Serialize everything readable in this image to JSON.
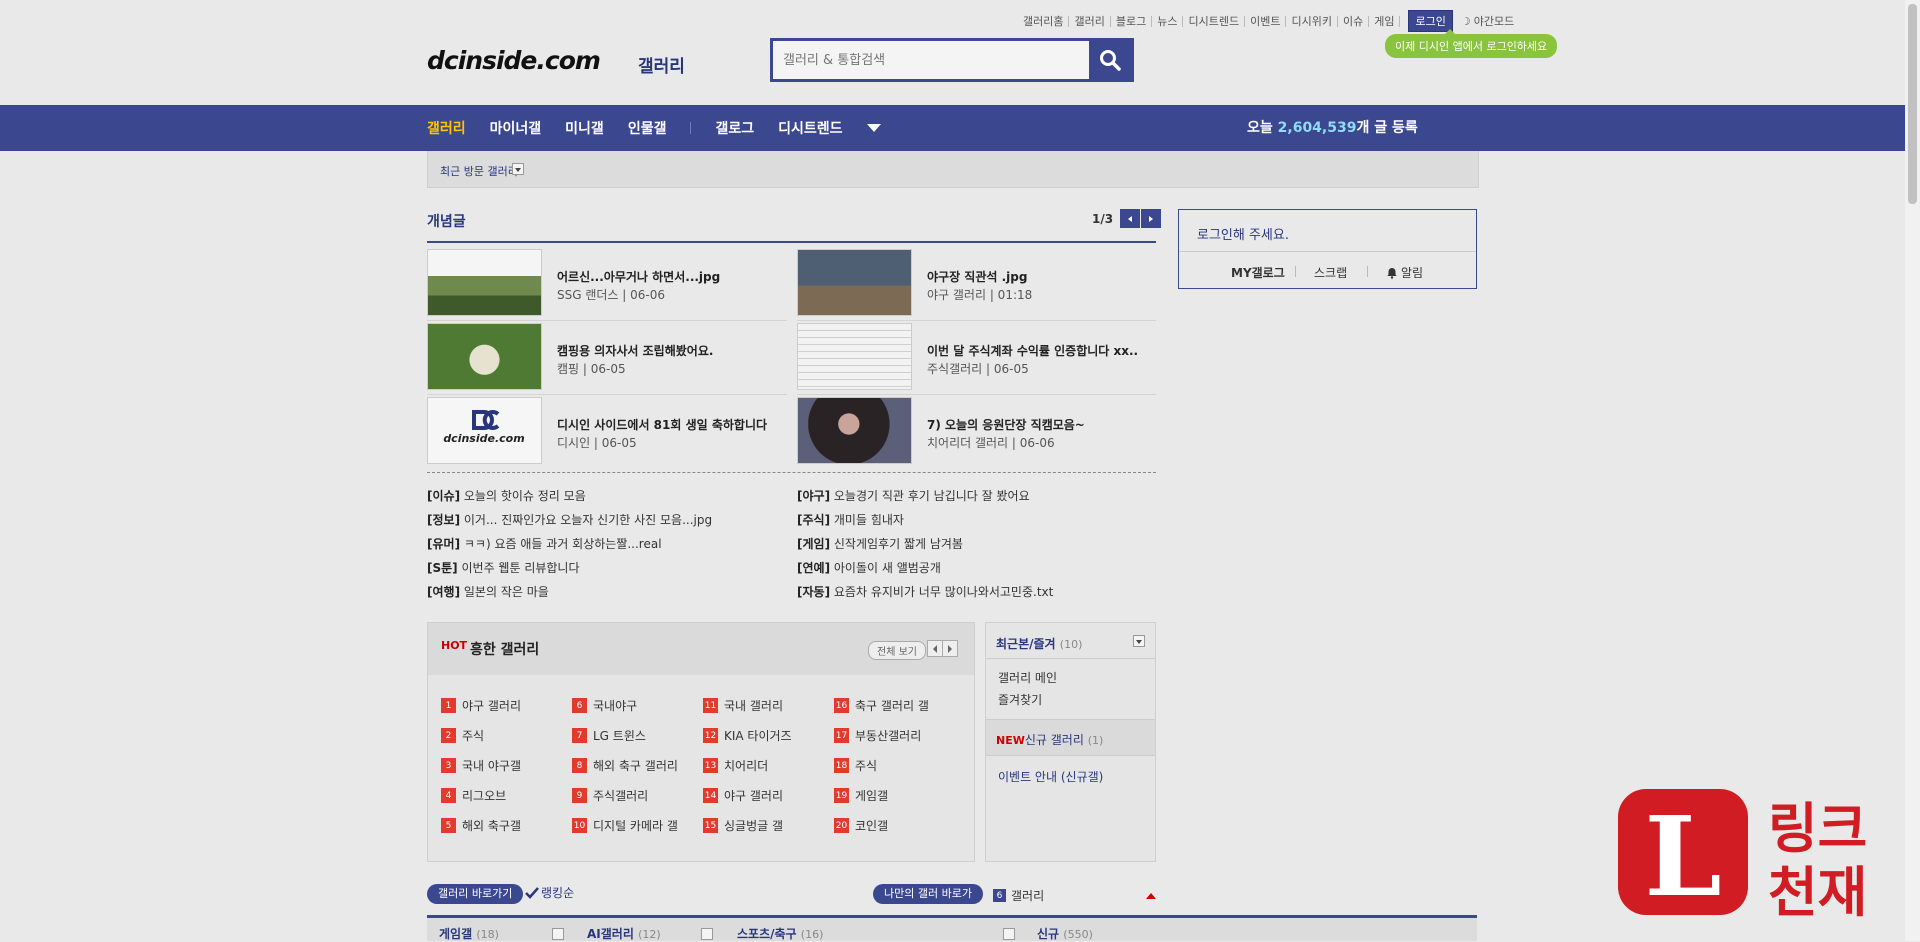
{
  "top_links": [
    "갤러리홈",
    "갤러리",
    "블로그",
    "뉴스",
    "디시트렌드",
    "이벤트",
    "디시위키",
    "이슈",
    "게임"
  ],
  "login_label": "로그인",
  "night_label": "야간모드",
  "bubble_text": "이제 디시인 앱에서 로그인하세요",
  "logo": {
    "text": "dcinside.com",
    "sub": "갤러리"
  },
  "search": {
    "placeholder": "갤러리 & 통합검색"
  },
  "nav": {
    "items": [
      "갤러리",
      "마이너갤",
      "미니갤",
      "인물갤",
      "갤로그",
      "디시트렌드"
    ],
    "count_prefix": "오늘 ",
    "count_value": "2,604,539",
    "count_suffix": "개 글 등록"
  },
  "subbar": {
    "label": "최근 방문 갤러리"
  },
  "headline": {
    "title": "개념글",
    "page": "1/3"
  },
  "thumbs": [
    {
      "title": "어르신...아무거나 하면서...jpg",
      "meta": "SSG 랜더스 | 06-06"
    },
    {
      "title": "야구장 직관석 .jpg",
      "meta": "야구 갤러리 | 01:18"
    },
    {
      "title": "캠핑용 의자사서 조립해봤어요.",
      "meta": "캠핑 | 06-05"
    },
    {
      "title": "이번 달 주식계좌 수익률 인증합니다 xx..",
      "meta": "주식갤러리 | 06-05"
    },
    {
      "title": "디시인 사이드에서 81회 생일 축하합니다",
      "meta": "디시인 | 06-05"
    },
    {
      "title": "7) 오늘의 응원단장 직캠모음~",
      "meta": "치어리더 갤러리 | 06-06"
    }
  ],
  "news_left": [
    {
      "head": "[이슈]",
      "text": "오늘의 핫이슈 정리 모음"
    },
    {
      "head": "[정보]",
      "text": "이거... 진짜인가요 오늘자 신기한 사진 모음...jpg"
    },
    {
      "head": "[유머]",
      "text": "ㅋㅋ) 요즘 애들 과거 회상하는짤...real"
    },
    {
      "head": "[S툰]",
      "text": "이번주 웹툰 리뷰합니다"
    },
    {
      "head": "[여행]",
      "text": "일본의 작은 마을"
    }
  ],
  "news_right": [
    {
      "head": "[야구]",
      "text": "오늘경기 직관 후기 남깁니다 잘 봤어요"
    },
    {
      "head": "[주식]",
      "text": "개미들 힘내자"
    },
    {
      "head": "[게임]",
      "text": "신작게임후기 짧게 남겨봄"
    },
    {
      "head": "[연예]",
      "text": "아이돌이 새 앨범공개"
    },
    {
      "head": "[자동]",
      "text": "요즘차 유지비가 너무 많이나와서고민중.txt"
    }
  ],
  "hot": {
    "badge": "HOT",
    "title": "흥한 갤러리",
    "all_label": "전체 보기",
    "items": [
      "야구 갤러리",
      "주식",
      "국내 야구갤",
      "리그오브",
      "해외 축구갤",
      "국내야구",
      "LG 트윈스",
      "해외 축구 갤러리",
      "주식갤러리",
      "디지털 카메라 갤",
      "국내 갤러리",
      "KIA 타이거즈",
      "치어리더",
      "야구 갤러리",
      "싱글벙글 갤",
      "축구 갤러리 갤",
      "부동산갤러리",
      "주식",
      "게임갤",
      "코인갤"
    ]
  },
  "login_box": {
    "msg": "로그인해 주세요.",
    "mygall": "MY갤로그",
    "scrap": "스크랩",
    "alarm": "알림"
  },
  "side": {
    "title": "최근본/즐겨",
    "count": "(10)",
    "items": [
      "갤러리 메인",
      "즐겨찾기"
    ],
    "new_badge": "NEW",
    "new_title": "신규 갤러리",
    "new_count": "(1)",
    "new_item": "이벤트 안내 (신규갤)"
  },
  "bottom": {
    "pill1": "갤러리 바로가기",
    "check_label": "랭킹순",
    "pill2": "나만의 갤러 바로가",
    "six_num": "6",
    "six_label": "갤러리",
    "cols": [
      {
        "label": "게임갤",
        "count": "(18)"
      },
      {
        "label": "AI갤러리",
        "count": "(12)"
      },
      {
        "label": "스포츠/축구",
        "count": "(16)"
      },
      {
        "label": "신규",
        "count": "(550)"
      }
    ]
  }
}
